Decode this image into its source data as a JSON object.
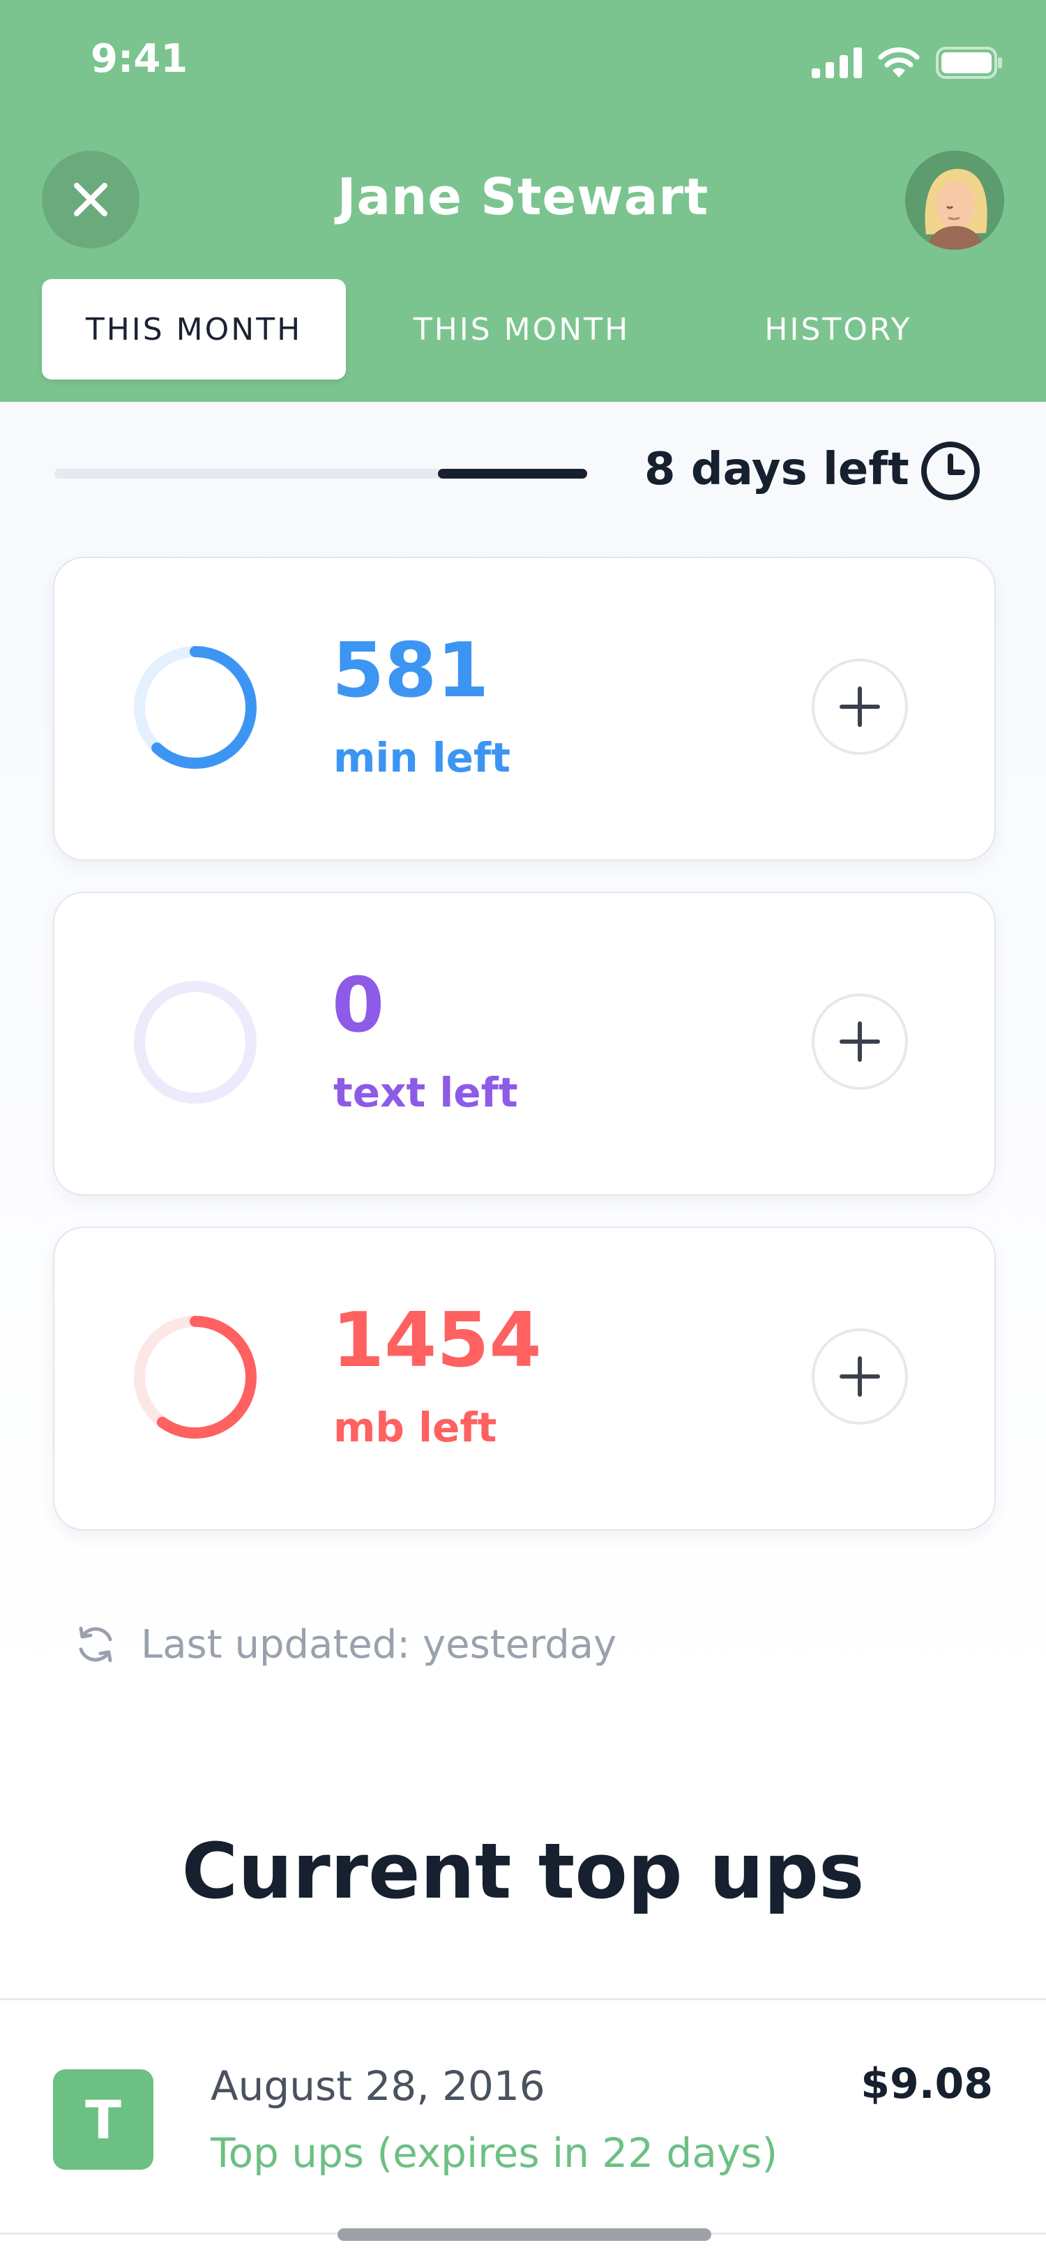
{
  "status_bar": {
    "time": "9:41"
  },
  "header": {
    "title": "Jane Stewart",
    "icons": {
      "close": "close-icon",
      "avatar": "avatar"
    },
    "tabs": [
      {
        "label": "THIS MONTH",
        "active": true
      },
      {
        "label": "THIS MONTH",
        "active": false
      },
      {
        "label": "HISTORY",
        "active": false
      }
    ]
  },
  "period": {
    "days_left_label": "8 days left",
    "elapsed_fraction": 0.72
  },
  "usage": [
    {
      "value": "581",
      "unit": "min left",
      "color": "#3d95f3",
      "track_color": "#e3f0fd",
      "remaining_fraction": 0.62
    },
    {
      "value": "0",
      "unit": "text left",
      "color": "#8e5ae8",
      "track_color": "#efe9fc",
      "remaining_fraction": 0.0
    },
    {
      "value": "1454",
      "unit": "mb left",
      "color": "#ff6060",
      "track_color": "#fde6e6",
      "remaining_fraction": 0.6
    }
  ],
  "last_updated": "Last updated: yesterday",
  "top_ups": {
    "section_title": "Current top ups",
    "items": [
      {
        "badge": "T",
        "date": "August 28, 2016",
        "description": "Top ups (expires in 22 days)",
        "price": "$9.08"
      }
    ]
  },
  "colors": {
    "header": "#7bc48f",
    "accent_green": "#6cc083",
    "text_dark": "#17202e"
  }
}
